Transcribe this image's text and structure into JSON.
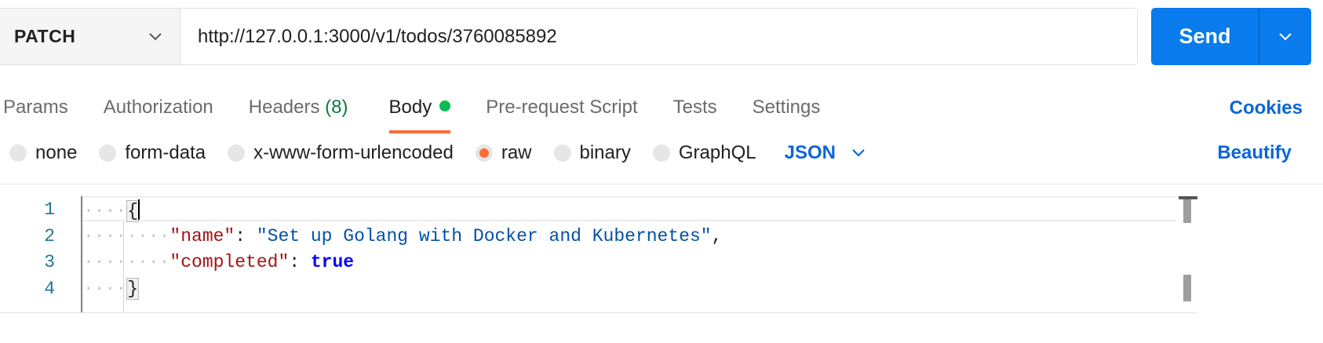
{
  "request": {
    "method": "PATCH",
    "url": "http://127.0.0.1:3000/v1/todos/3760085892",
    "send_label": "Send"
  },
  "tabs": [
    {
      "label": "Params"
    },
    {
      "label": "Authorization"
    },
    {
      "label": "Headers",
      "count": "(8)"
    },
    {
      "label": "Body",
      "active": true
    },
    {
      "label": "Pre-request Script"
    },
    {
      "label": "Tests"
    },
    {
      "label": "Settings"
    }
  ],
  "cookies_label": "Cookies",
  "body_types": [
    {
      "label": "none",
      "selected": false
    },
    {
      "label": "form-data",
      "selected": false
    },
    {
      "label": "x-www-form-urlencoded",
      "selected": false
    },
    {
      "label": "raw",
      "selected": true
    },
    {
      "label": "binary",
      "selected": false
    },
    {
      "label": "GraphQL",
      "selected": false
    }
  ],
  "language": "JSON",
  "beautify_label": "Beautify",
  "editor": {
    "line_numbers": [
      "1",
      "2",
      "3",
      "4"
    ],
    "open_brace": "{",
    "close_brace": "}",
    "key1": "\"name\"",
    "colon": ": ",
    "value1": "\"Set up Golang with Docker and Kubernetes\"",
    "comma": ",",
    "key2": "\"completed\"",
    "value2": "true"
  },
  "colors": {
    "accent": "#ff6c37",
    "send_button": "#097bed",
    "link": "#0b66d6",
    "status_dot": "#0cbb52"
  }
}
